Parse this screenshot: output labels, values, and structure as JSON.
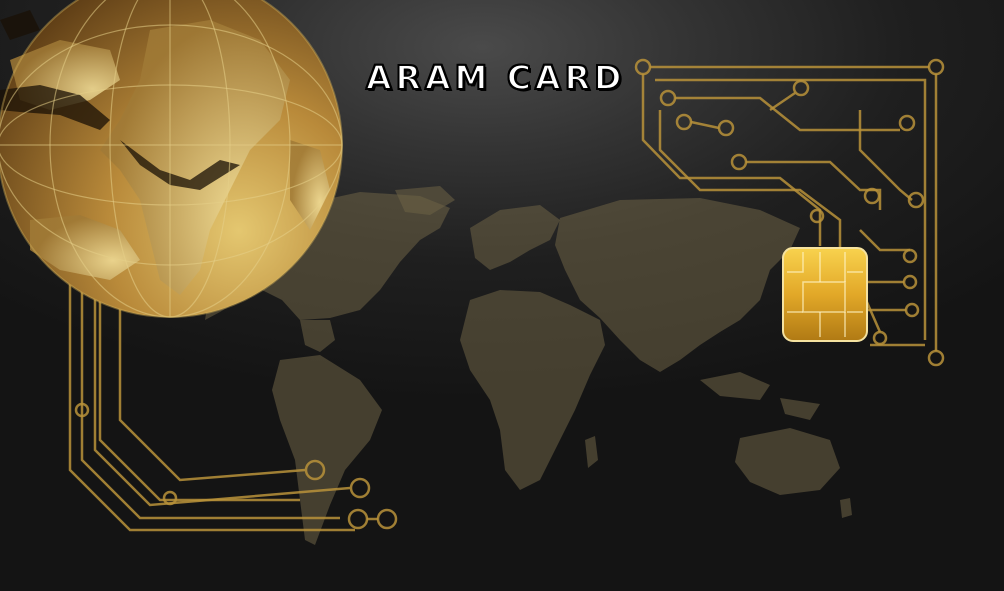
{
  "card": {
    "title": "ARAM CARD",
    "colors": {
      "background": "#1a1a1a",
      "circuit_gold": "#b8923a",
      "globe_gold": "#c9a24a",
      "map_tint": "#7a6a45",
      "chip_gold": "#e8b52a"
    },
    "icons": {
      "globe": "globe-icon",
      "world_map": "world-map-icon",
      "chip": "smart-chip-icon"
    }
  }
}
